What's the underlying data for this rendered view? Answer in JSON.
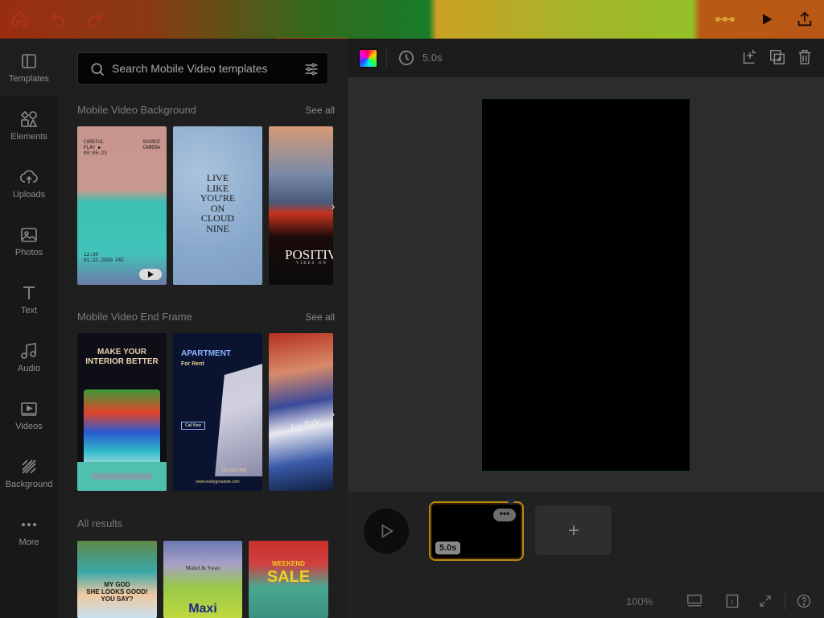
{
  "topbar": {
    "home_icon": "home-icon",
    "undo_icon": "undo-icon",
    "redo_icon": "redo-icon",
    "effects_icon": "sparkle-icon",
    "play_icon": "play-icon",
    "share_icon": "share-icon"
  },
  "rail": {
    "items": [
      {
        "label": "Templates",
        "icon": "templates-icon"
      },
      {
        "label": "Elements",
        "icon": "elements-icon"
      },
      {
        "label": "Uploads",
        "icon": "upload-icon"
      },
      {
        "label": "Photos",
        "icon": "photos-icon"
      },
      {
        "label": "Text",
        "icon": "text-icon"
      },
      {
        "label": "Audio",
        "icon": "music-icon"
      },
      {
        "label": "Videos",
        "icon": "video-icon"
      },
      {
        "label": "Background",
        "icon": "background-icon"
      },
      {
        "label": "More",
        "icon": "more-icon"
      }
    ]
  },
  "search": {
    "placeholder": "Search Mobile Video templates"
  },
  "sections": {
    "background": {
      "title": "Mobile Video Background",
      "see_all": "See all",
      "thumbs": [
        {
          "lines_top": [
            "CAREFUL",
            "PLAY ▶",
            "00:05:23"
          ],
          "lines_right": [
            "SOURCE",
            "CAMERA"
          ],
          "lines_bottom": [
            "12:30",
            "01.22.2020 FRI"
          ]
        },
        {
          "text": [
            "LIVE",
            "LIKE",
            "YOU'RE",
            "ON",
            "CLOUD",
            "NINE"
          ]
        },
        {
          "text": [
            "POSITIV"
          ],
          "sub": "VIBES ON"
        }
      ]
    },
    "endframe": {
      "title": "Mobile Video End Frame",
      "see_all": "See all",
      "thumbs": [
        {
          "title": [
            "MAKE YOUR",
            "INTERIOR BETTER"
          ]
        },
        {
          "title": "APARTMENT",
          "sub": "For Rent",
          "footer": "www.realtygreatsite.com",
          "phone": "123-456-7890",
          "cta": "Call Now"
        },
        {
          "text": "Joy Ride"
        }
      ]
    },
    "all_results": {
      "title": "All results",
      "thumbs": [
        {
          "text": [
            "MY GOD",
            "SHE LOOKS GOOD!",
            "YOU SAY?"
          ]
        },
        {
          "text": "Maxi",
          "sub": "Mabel & Swan"
        },
        {
          "title": "WEEKEND",
          "big": "SALE"
        }
      ]
    }
  },
  "editor": {
    "duration": "5.0s",
    "clip_duration": "5.0s",
    "clip_more": "•••",
    "zoom": "100%",
    "page_count": "1"
  },
  "colors": {
    "accent_clip": "#b48a12",
    "canvas": "#000000",
    "editor_bg": "#2c2c2c"
  }
}
